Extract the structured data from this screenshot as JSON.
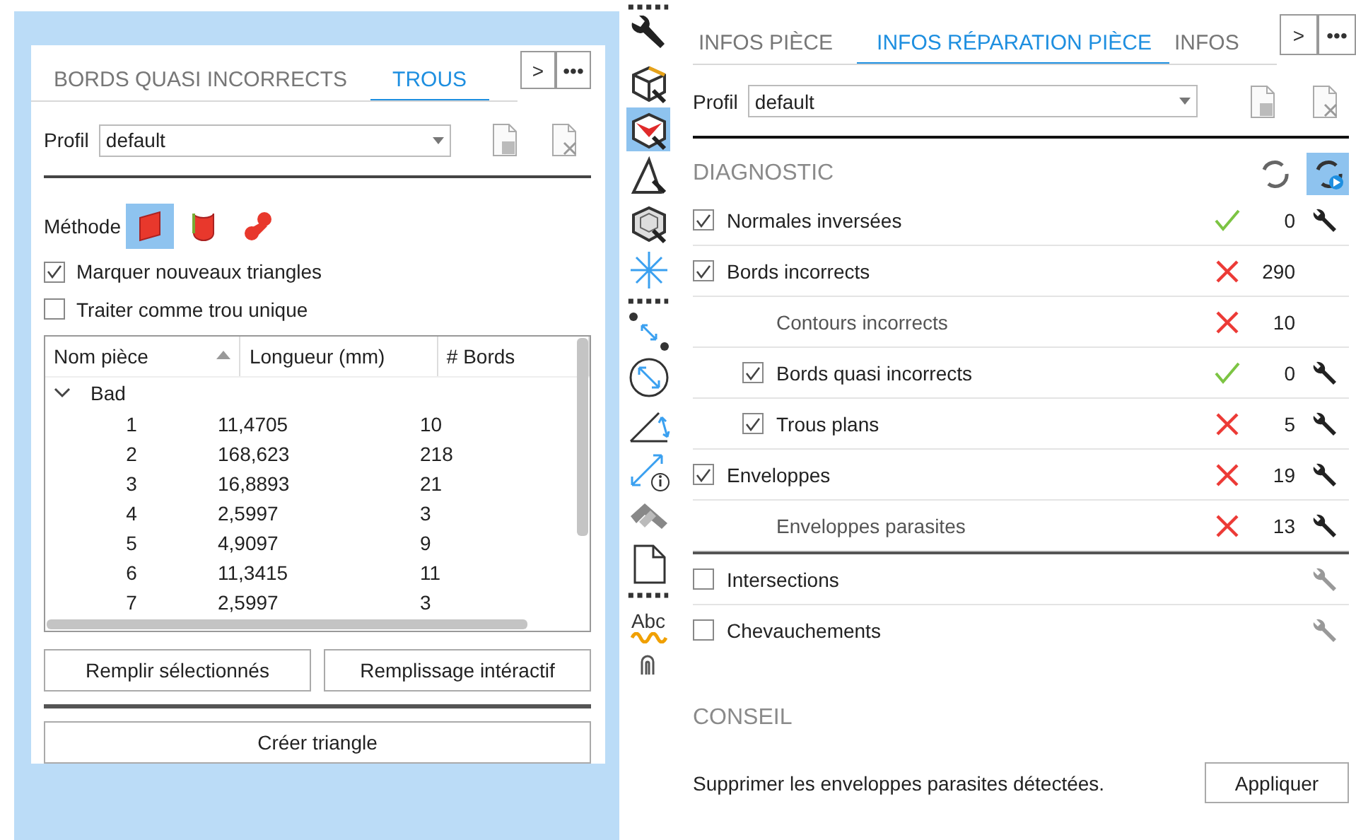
{
  "left_panel": {
    "tabs": [
      {
        "label": "BORDS QUASI INCORRECTS",
        "selected": false
      },
      {
        "label": "TROUS",
        "selected": true
      }
    ],
    "nav_buttons": [
      ">",
      "•••"
    ],
    "profile": {
      "label": "Profil",
      "value": "default"
    },
    "method": {
      "label": "Méthode",
      "options": [
        {
          "kind": "patch",
          "selected": true
        },
        {
          "kind": "bridge",
          "selected": false
        },
        {
          "kind": "blob",
          "selected": false
        }
      ]
    },
    "checkboxes": [
      {
        "label": "Marquer nouveaux triangles",
        "checked": true
      },
      {
        "label": "Traiter comme trou unique",
        "checked": false
      }
    ],
    "table": {
      "columns": [
        "Nom pièce",
        "Longueur (mm)",
        "# Bords"
      ],
      "groups": [
        {
          "label": "Bad",
          "expanded": true,
          "rows": [
            [
              "1",
              "11,4705",
              "10"
            ],
            [
              "2",
              "168,623",
              "218"
            ],
            [
              "3",
              "16,8893",
              "21"
            ],
            [
              "4",
              "2,5997",
              "3"
            ],
            [
              "5",
              "4,9097",
              "9"
            ],
            [
              "6",
              "11,3415",
              "11"
            ],
            [
              "7",
              "2,5997",
              "3"
            ]
          ]
        }
      ]
    },
    "buttons": [
      "Remplir sélectionnés",
      "Remplissage intéractif"
    ],
    "bottom_button": "Créer triangle"
  },
  "toolbar": [
    {
      "kind": "dots"
    },
    {
      "kind": "wrench",
      "selected": false
    },
    {
      "kind": "cube-edge",
      "selected": false
    },
    {
      "kind": "cube-face",
      "selected": true
    },
    {
      "kind": "triangle",
      "selected": false
    },
    {
      "kind": "cube-wire",
      "selected": false
    },
    {
      "kind": "star",
      "selected": false
    },
    {
      "kind": "dots"
    },
    {
      "kind": "points",
      "selected": false
    },
    {
      "kind": "circle",
      "selected": false
    },
    {
      "kind": "angle",
      "selected": false
    },
    {
      "kind": "distance",
      "selected": false
    },
    {
      "kind": "hammer",
      "selected": false
    },
    {
      "kind": "document",
      "selected": false
    },
    {
      "kind": "dots"
    },
    {
      "kind": "text",
      "label": "Abc"
    },
    {
      "kind": "clip",
      "selected": false
    }
  ],
  "right_panel": {
    "tabs": [
      {
        "label": "INFOS PIÈCE",
        "selected": false
      },
      {
        "label": "INFOS RÉPARATION PIÈCE",
        "selected": true
      },
      {
        "label": "INFOS",
        "selected": false
      }
    ],
    "nav_buttons": [
      ">",
      "•••"
    ],
    "profile": {
      "label": "Profil",
      "value": "default"
    },
    "diagnostic": {
      "title": "DIAGNOSTIC",
      "auto_run": true,
      "items": [
        {
          "label": "Normales inversées",
          "checked": true,
          "passed": true,
          "count": "0",
          "tool_enabled": true
        },
        {
          "label": "Bords incorrects",
          "checked": true,
          "passed": false,
          "count": "290",
          "children": [
            {
              "label": "Contours incorrects",
              "passed": false,
              "count": "10"
            },
            {
              "label": "Bords quasi incorrects",
              "checked": true,
              "passed": true,
              "count": "0",
              "tool_enabled": true
            },
            {
              "label": "Trous plans",
              "checked": true,
              "passed": false,
              "count": "5",
              "tool_enabled": true
            }
          ]
        },
        {
          "label": "Enveloppes",
          "checked": true,
          "passed": false,
          "count": "19",
          "tool_enabled": true,
          "children": [
            {
              "label": "Enveloppes parasites",
              "passed": false,
              "count": "13",
              "tool_enabled": true
            }
          ]
        },
        {
          "label": "Intersections",
          "checked": false,
          "tool_enabled": false,
          "separator_before": true
        },
        {
          "label": "Chevauchements",
          "checked": false,
          "tool_enabled": false
        }
      ]
    },
    "advice": {
      "title": "CONSEIL",
      "text": "Supprimer les enveloppes parasites détectées.",
      "button": "Appliquer"
    }
  }
}
